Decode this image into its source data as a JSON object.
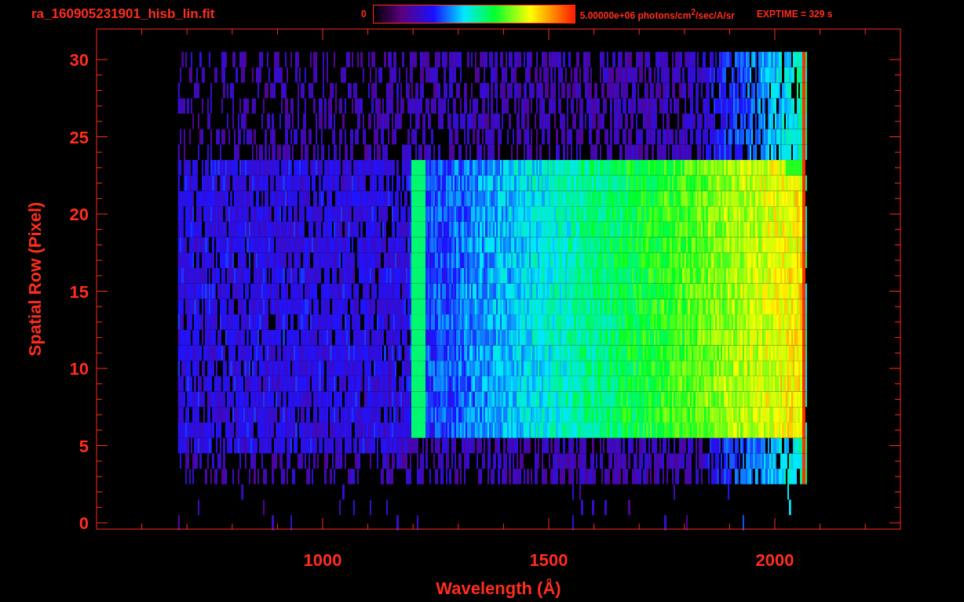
{
  "header": {
    "title": "ra_160905231901_hisb_lin.fit",
    "colorbar": {
      "min_label": "0",
      "max_label": "5.00000e+06 photons/cm$^{2}$/sec/A/sr"
    },
    "exposure": "EXPTIME = 329 s"
  },
  "plot": {
    "xlabel": "Wavelength (Å)",
    "ylabel": "Spatial Row (Pixel)",
    "xtick_labels": [
      "1000",
      "1500",
      "2000"
    ],
    "ytick_labels": [
      "30",
      "25",
      "20",
      "15",
      "10",
      "5",
      "0"
    ]
  }
}
